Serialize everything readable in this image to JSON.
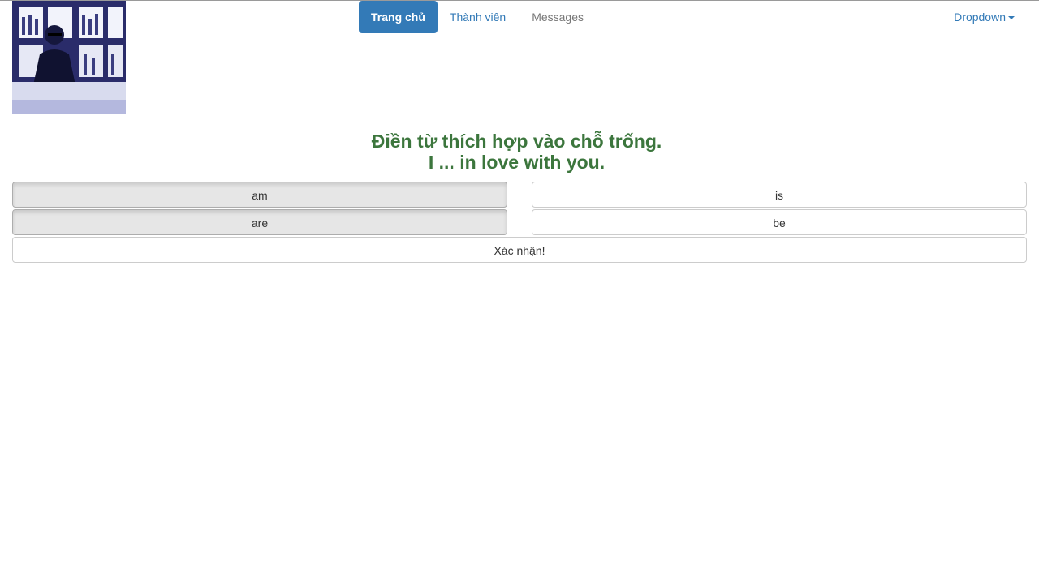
{
  "nav": {
    "items": [
      {
        "label": "Trang chủ"
      },
      {
        "label": "Thành viên"
      },
      {
        "label": "Messages"
      }
    ],
    "dropdown_label": "Dropdown"
  },
  "question": {
    "line1": "Điền từ thích hợp vào chỗ trống.",
    "line2": "I ... in love with you."
  },
  "options": [
    {
      "label": "am"
    },
    {
      "label": "is"
    },
    {
      "label": "are"
    },
    {
      "label": "be"
    }
  ],
  "submit_label": "Xác nhận!",
  "colors": {
    "brand": "#337ab7",
    "question": "#3c763d"
  }
}
